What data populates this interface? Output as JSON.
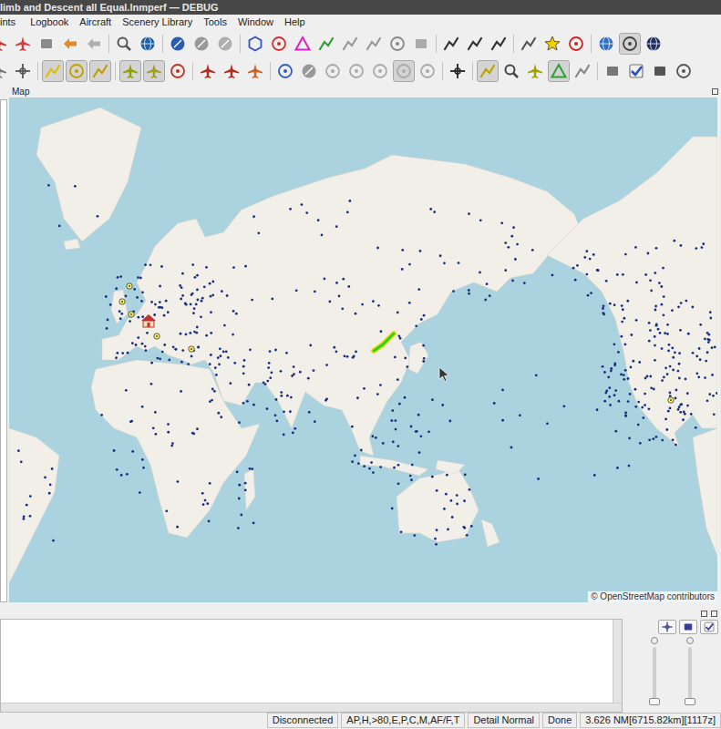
{
  "window": {
    "title": "limb and Descent all Equal.lnmperf — DEBUG"
  },
  "menu": [
    "ints",
    "Logbook",
    "Aircraft",
    "Scenery Library",
    "Tools",
    "Window",
    "Help"
  ],
  "toolbars": [
    {
      "groups": [
        [
          {
            "kind": "plane",
            "color": "#c0392b",
            "checked": false
          },
          {
            "kind": "plane",
            "color": "#d04040",
            "checked": false
          },
          {
            "kind": "square",
            "color": "#8a8a8a",
            "checked": false
          },
          {
            "kind": "arrow",
            "color": "#e08a2a",
            "checked": false
          },
          {
            "kind": "arrow",
            "color": "#b0b0b0",
            "checked": false
          }
        ],
        [
          {
            "kind": "magnifier",
            "color": "#555555",
            "checked": false
          },
          {
            "kind": "globe",
            "color": "#1f5fa8",
            "checked": false
          }
        ],
        [
          {
            "kind": "circle",
            "color": "#2a5db0",
            "checked": false
          },
          {
            "kind": "circle",
            "color": "#9a9a9a",
            "checked": false
          },
          {
            "kind": "circle",
            "color": "#b0b0b0",
            "checked": false
          }
        ],
        [
          {
            "kind": "hexagon",
            "color": "#3050c0",
            "checked": false
          },
          {
            "kind": "ring",
            "color": "#d03030",
            "checked": false
          },
          {
            "kind": "triangle",
            "color": "#e020c0",
            "checked": false
          },
          {
            "kind": "line",
            "color": "#30a030",
            "checked": false
          },
          {
            "kind": "line",
            "color": "#999999",
            "checked": false
          },
          {
            "kind": "line",
            "color": "#999999",
            "checked": false
          },
          {
            "kind": "ring",
            "color": "#888888",
            "checked": false
          },
          {
            "kind": "square",
            "color": "#aaaaaa",
            "checked": false
          }
        ],
        [
          {
            "kind": "line",
            "color": "#333333",
            "checked": false
          },
          {
            "kind": "line",
            "color": "#333333",
            "checked": false
          },
          {
            "kind": "line",
            "color": "#333333",
            "checked": false
          }
        ],
        [
          {
            "kind": "line",
            "color": "#555555",
            "checked": false
          },
          {
            "kind": "star",
            "color": "#f0d000",
            "checked": false
          },
          {
            "kind": "ring",
            "color": "#d02020",
            "checked": false
          }
        ],
        [
          {
            "kind": "globe",
            "color": "#3070c0",
            "checked": false
          },
          {
            "kind": "ring",
            "color": "#444444",
            "checked": true
          },
          {
            "kind": "globe",
            "color": "#203060",
            "checked": false
          }
        ]
      ]
    },
    {
      "groups": [
        [
          {
            "kind": "plane",
            "color": "#777777",
            "checked": false
          },
          {
            "kind": "cross",
            "color": "#555555",
            "checked": false
          }
        ],
        [
          {
            "kind": "line",
            "color": "#e0c000",
            "checked": true
          },
          {
            "kind": "ring",
            "color": "#c0a000",
            "checked": true
          },
          {
            "kind": "line",
            "color": "#c0a000",
            "checked": true
          }
        ],
        [
          {
            "kind": "plane",
            "color": "#90a000",
            "checked": true
          },
          {
            "kind": "plane",
            "color": "#a0a020",
            "checked": true
          },
          {
            "kind": "ring",
            "color": "#c03020",
            "checked": false
          }
        ],
        [
          {
            "kind": "plane",
            "color": "#b03020",
            "checked": false
          },
          {
            "kind": "plane",
            "color": "#b03020",
            "checked": false
          },
          {
            "kind": "plane",
            "color": "#d06020",
            "checked": false
          }
        ],
        [
          {
            "kind": "ring",
            "color": "#3060c0",
            "checked": false
          },
          {
            "kind": "circle",
            "color": "#999999",
            "checked": false
          },
          {
            "kind": "ring",
            "color": "#aaaaaa",
            "checked": false
          },
          {
            "kind": "ring",
            "color": "#aaaaaa",
            "checked": false
          },
          {
            "kind": "ring",
            "color": "#aaaaaa",
            "checked": false
          },
          {
            "kind": "ring",
            "color": "#aaaaaa",
            "checked": true
          },
          {
            "kind": "ring",
            "color": "#aaaaaa",
            "checked": false
          }
        ],
        [
          {
            "kind": "cross",
            "color": "#222222",
            "checked": false
          }
        ],
        [
          {
            "kind": "line",
            "color": "#c0a000",
            "checked": true
          },
          {
            "kind": "magnifier",
            "color": "#444444",
            "checked": false
          },
          {
            "kind": "plane",
            "color": "#a0a000",
            "checked": false
          },
          {
            "kind": "triangle",
            "color": "#30a030",
            "checked": true
          },
          {
            "kind": "line",
            "color": "#888888",
            "checked": false
          }
        ],
        [
          {
            "kind": "square",
            "color": "#777777",
            "checked": false
          },
          {
            "kind": "check",
            "color": "#2050c0",
            "checked": false
          },
          {
            "kind": "square",
            "color": "#555555",
            "checked": false
          },
          {
            "kind": "ring",
            "color": "#555555",
            "checked": false
          }
        ]
      ]
    }
  ],
  "map": {
    "title": "Map",
    "attribution": "© OpenStreetMap contributors"
  },
  "bottom_panel": {
    "sliders": [
      {
        "level": 0
      },
      {
        "level": 0
      }
    ]
  },
  "status_bar": [
    "Disconnected",
    "AP,H,>80,E,P,C,M,AF/F,T",
    "Detail Normal",
    "Done",
    "3.626 NM[6715.82km][1117z]"
  ]
}
